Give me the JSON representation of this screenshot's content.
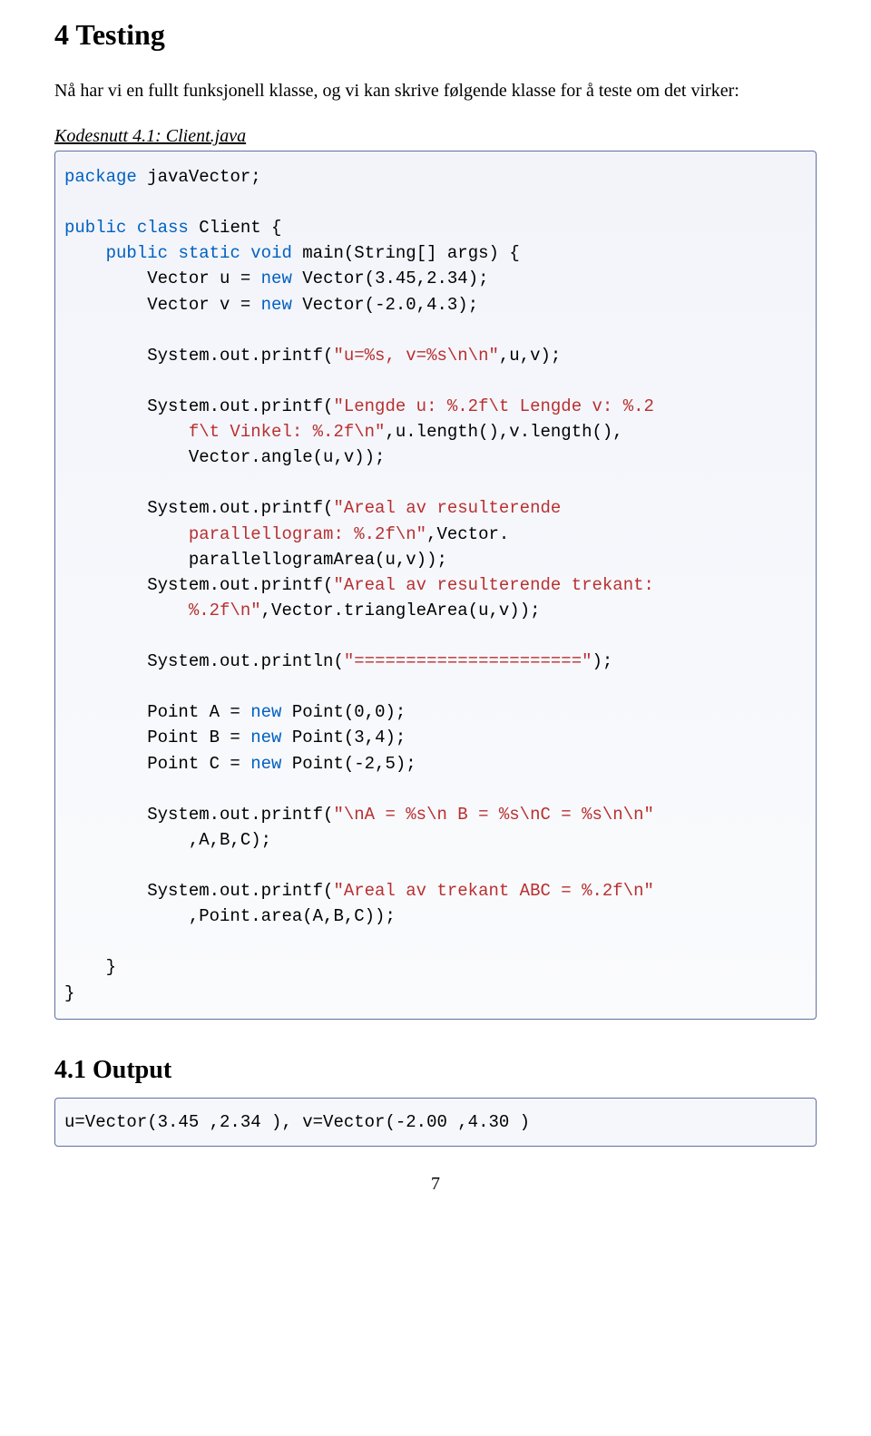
{
  "section": {
    "number": "4",
    "title": "Testing",
    "intro": "Nå har vi en fullt funksjonell klasse, og vi kan skrive følgende klasse for å teste om det virker:",
    "snippet_label": "Kodesnutt 4.1: Client.java"
  },
  "code": {
    "l1_package": "package",
    "l1_rest": " javaVector;",
    "l2_public": "public",
    "l2_class": "class",
    "l2_client": " Client {",
    "l3_indent": "    ",
    "l3_public": "public",
    "l3_static": "static",
    "l3_void": "void",
    "l3_main": " main(String[] args) {",
    "l4_indent": "        Vector u = ",
    "l4_new": "new",
    "l4_rest": " Vector(3.45,2.34);",
    "l5_indent": "        Vector v = ",
    "l5_new": "new",
    "l5_rest": " Vector(-2.0,4.3);",
    "l6_indent": "        System.out.printf(",
    "l6_str": "\"u=%s, v=%s\\n\\n\"",
    "l6_rest": ",u,v);",
    "l7_indent": "        System.out.printf(",
    "l7_str": "\"Lengde u: %.2f\\t Lengde v: %.2\n            f\\t Vinkel: %.2f\\n\"",
    "l7_rest": ",u.length(),v.length(),\n            Vector.angle(u,v));",
    "l8_indent": "        System.out.printf(",
    "l8_str": "\"Areal av resulterende\n            parallellogram: %.2f\\n\"",
    "l8_rest": ",Vector.\n            parallellogramArea(u,v));",
    "l9_indent": "        System.out.printf(",
    "l9_str": "\"Areal av resulterende trekant:\n            %.2f\\n\"",
    "l9_rest": ",Vector.triangleArea(u,v));",
    "l10_indent": "        System.out.println(",
    "l10_str": "\"======================\"",
    "l10_rest": ");",
    "l11_indent": "        Point A = ",
    "l11_new": "new",
    "l11_rest": " Point(0,0);",
    "l12_indent": "        Point B = ",
    "l12_new": "new",
    "l12_rest": " Point(3,4);",
    "l13_indent": "        Point C = ",
    "l13_new": "new",
    "l13_rest": " Point(-2,5);",
    "l14_indent": "        System.out.printf(",
    "l14_str": "\"\\nA = %s\\n B = %s\\nC = %s\\n\\n\"",
    "l14_rest": "\n            ,A,B,C);",
    "l15_indent": "        System.out.printf(",
    "l15_str": "\"Areal av trekant ABC = %.2f\\n\"",
    "l15_rest": "\n            ,Point.area(A,B,C));",
    "close1": "    }",
    "close2": "}"
  },
  "subsection": {
    "number": "4.1",
    "title": "Output"
  },
  "output": "u=Vector(3.45 ,2.34 ), v=Vector(-2.00 ,4.30 )",
  "page_number": "7"
}
